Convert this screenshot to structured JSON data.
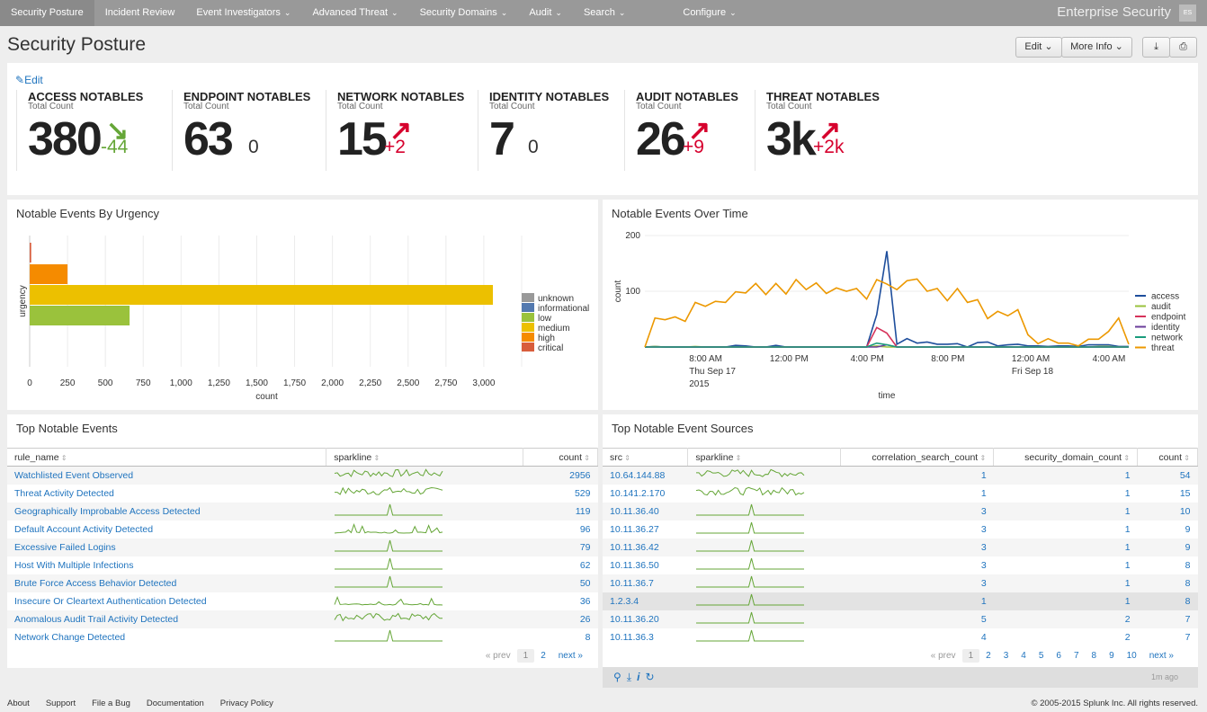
{
  "nav": {
    "tabs": [
      {
        "label": "Security Posture",
        "dropdown": false
      },
      {
        "label": "Incident Review",
        "dropdown": false
      },
      {
        "label": "Event Investigators",
        "dropdown": true
      },
      {
        "label": "Advanced Threat",
        "dropdown": true
      },
      {
        "label": "Security Domains",
        "dropdown": true
      },
      {
        "label": "Audit",
        "dropdown": true
      },
      {
        "label": "Search",
        "dropdown": true
      },
      {
        "label": "Configure",
        "dropdown": true
      }
    ],
    "brand": "Enterprise Security",
    "app_badge": "ES"
  },
  "page": {
    "title": "Security Posture",
    "edit_label": "Edit",
    "more_info_label": "More Info",
    "edit_link": "Edit"
  },
  "kpis": [
    {
      "title": "ACCESS NOTABLES",
      "subtitle": "Total Count",
      "value": "380",
      "delta": "-44",
      "trend": "down",
      "color": "#65a637"
    },
    {
      "title": "ENDPOINT NOTABLES",
      "subtitle": "Total Count",
      "value": "63",
      "delta": "0",
      "trend": "none",
      "color": "#333333"
    },
    {
      "title": "NETWORK NOTABLES",
      "subtitle": "Total Count",
      "value": "15",
      "delta": "+2",
      "trend": "up",
      "color": "#d6002d"
    },
    {
      "title": "IDENTITY NOTABLES",
      "subtitle": "Total Count",
      "value": "7",
      "delta": "0",
      "trend": "none",
      "color": "#333333"
    },
    {
      "title": "AUDIT NOTABLES",
      "subtitle": "Total Count",
      "value": "26",
      "delta": "+9",
      "trend": "up",
      "color": "#d6002d"
    },
    {
      "title": "THREAT NOTABLES",
      "subtitle": "Total Count",
      "value": "3k",
      "delta": "+2k",
      "trend": "up",
      "color": "#d6002d"
    }
  ],
  "chart_data": [
    {
      "type": "bar",
      "orientation": "horizontal",
      "title": "Notable Events By Urgency",
      "xlabel": "count",
      "ylabel": "urgency",
      "xlim": [
        0,
        3250
      ],
      "xticks": [
        0,
        250,
        500,
        750,
        1000,
        1250,
        1500,
        1750,
        2000,
        2250,
        2500,
        2750,
        3000
      ],
      "xtick_labels": [
        "0",
        "250",
        "500",
        "750",
        "1,000",
        "1,250",
        "1,500",
        "1,750",
        "2,000",
        "2,250",
        "2,500",
        "2,750",
        "3,000"
      ],
      "grid": true,
      "legend": "right",
      "series": [
        {
          "name": "unknown",
          "value": 0,
          "color": "#999999"
        },
        {
          "name": "informational",
          "value": 0,
          "color": "#5379af"
        },
        {
          "name": "low",
          "value": 660,
          "color": "#9ac23c"
        },
        {
          "name": "medium",
          "value": 3060,
          "color": "#ecc000"
        },
        {
          "name": "high",
          "value": 250,
          "color": "#f58b00"
        },
        {
          "name": "critical",
          "value": 10,
          "color": "#d85d3c"
        }
      ]
    },
    {
      "type": "line",
      "title": "Notable Events Over Time",
      "xlabel": "time",
      "ylabel": "count",
      "ylim": [
        0,
        200
      ],
      "yticks": [
        100,
        200
      ],
      "x_start": "2015-09-17 05:00",
      "x_step_minutes": 30,
      "xtick_labels": [
        {
          "at_index": 6,
          "lines": [
            "8:00 AM",
            "Thu Sep 17",
            "2015"
          ]
        },
        {
          "at_index": 14,
          "lines": [
            "12:00 PM"
          ]
        },
        {
          "at_index": 22,
          "lines": [
            "4:00 PM"
          ]
        },
        {
          "at_index": 30,
          "lines": [
            "8:00 PM"
          ]
        },
        {
          "at_index": 38,
          "lines": [
            "12:00 AM",
            "Fri Sep 18"
          ]
        },
        {
          "at_index": 46,
          "lines": [
            "4:00 AM"
          ]
        }
      ],
      "legend": "right",
      "grid": true,
      "series": [
        {
          "name": "access",
          "color": "#1e4e9c",
          "values": [
            0,
            1,
            0,
            0,
            0,
            0,
            0,
            0,
            0,
            3,
            2,
            0,
            0,
            3,
            0,
            0,
            0,
            0,
            0,
            0,
            0,
            0,
            0,
            58,
            172,
            5,
            15,
            7,
            9,
            5,
            5,
            6,
            0,
            8,
            9,
            2,
            4,
            5,
            2,
            2,
            1,
            2,
            2,
            1,
            4,
            4,
            4,
            1,
            1
          ]
        },
        {
          "name": "audit",
          "color": "#9ac23c",
          "values": [
            0,
            1,
            0,
            0,
            0,
            1,
            0,
            0,
            0,
            0,
            0,
            0,
            0,
            0,
            0,
            0,
            0,
            0,
            0,
            0,
            0,
            0,
            0,
            2,
            0,
            0,
            0,
            0,
            0,
            0,
            0,
            0,
            0,
            0,
            0,
            0,
            0,
            0,
            0,
            0,
            0,
            0,
            0,
            0,
            0,
            1,
            1,
            0,
            0
          ]
        },
        {
          "name": "endpoint",
          "color": "#d6335a",
          "values": [
            0,
            0,
            0,
            0,
            0,
            0,
            0,
            0,
            0,
            0,
            0,
            0,
            0,
            0,
            0,
            0,
            0,
            0,
            0,
            0,
            0,
            0,
            0,
            35,
            25,
            0,
            0,
            0,
            0,
            0,
            0,
            0,
            0,
            0,
            0,
            0,
            0,
            0,
            0,
            0,
            0,
            0,
            0,
            0,
            0,
            0,
            0,
            0,
            0
          ]
        },
        {
          "name": "identity",
          "color": "#6a3d9a",
          "values": [
            0,
            0,
            0,
            0,
            0,
            0,
            0,
            0,
            0,
            0,
            0,
            0,
            0,
            0,
            0,
            0,
            0,
            0,
            0,
            0,
            0,
            0,
            0,
            0,
            4,
            0,
            0,
            0,
            0,
            0,
            0,
            0,
            0,
            0,
            0,
            0,
            0,
            0,
            0,
            0,
            0,
            0,
            0,
            0,
            0,
            0,
            0,
            0,
            0
          ]
        },
        {
          "name": "network",
          "color": "#1a9c7c",
          "values": [
            0,
            0,
            0,
            0,
            0,
            0,
            0,
            0,
            0,
            0,
            0,
            0,
            0,
            0,
            0,
            0,
            0,
            0,
            0,
            0,
            0,
            0,
            0,
            7,
            4,
            0,
            0,
            0,
            0,
            0,
            0,
            0,
            0,
            0,
            0,
            0,
            0,
            0,
            0,
            0,
            0,
            0,
            0,
            0,
            0,
            0,
            0,
            0,
            0
          ]
        },
        {
          "name": "threat",
          "color": "#ec9800",
          "values": [
            0,
            52,
            49,
            54,
            46,
            80,
            73,
            82,
            80,
            99,
            97,
            114,
            94,
            114,
            95,
            121,
            103,
            115,
            96,
            106,
            100,
            105,
            86,
            121,
            113,
            103,
            119,
            122,
            100,
            105,
            83,
            105,
            80,
            85,
            51,
            64,
            56,
            67,
            22,
            6,
            15,
            7,
            7,
            2,
            14,
            14,
            28,
            52,
            5
          ]
        }
      ]
    }
  ],
  "top_events": {
    "title": "Top Notable Events",
    "columns": [
      "rule_name",
      "sparkline",
      "count"
    ],
    "rows": [
      [
        "Watchlisted Event Observed",
        "dense",
        "2956"
      ],
      [
        "Threat Activity Detected",
        "dense",
        "529"
      ],
      [
        "Geographically Improbable Access Detected",
        "spike",
        "119"
      ],
      [
        "Default Account Activity Detected",
        "sparse",
        "96"
      ],
      [
        "Excessive Failed Logins",
        "spike",
        "79"
      ],
      [
        "Host With Multiple Infections",
        "spike",
        "62"
      ],
      [
        "Brute Force Access Behavior Detected",
        "spike",
        "50"
      ],
      [
        "Insecure Or Cleartext Authentication Detected",
        "sparse",
        "36"
      ],
      [
        "Anomalous Audit Trail Activity Detected",
        "dense",
        "26"
      ],
      [
        "Network Change Detected",
        "spike",
        "8"
      ]
    ],
    "pager": {
      "prev": "« prev",
      "pages": [
        "1",
        "2"
      ],
      "current": "1",
      "next": "next »"
    }
  },
  "top_sources": {
    "title": "Top Notable Event Sources",
    "columns": [
      "src",
      "sparkline",
      "correlation_search_count",
      "security_domain_count",
      "count"
    ],
    "rows": [
      [
        "10.64.144.88",
        "dense",
        "1",
        "1",
        "54"
      ],
      [
        "10.141.2.170",
        "dense",
        "1",
        "1",
        "15"
      ],
      [
        "10.11.36.40",
        "spike",
        "3",
        "1",
        "10"
      ],
      [
        "10.11.36.27",
        "spike",
        "3",
        "1",
        "9"
      ],
      [
        "10.11.36.42",
        "spike",
        "3",
        "1",
        "9"
      ],
      [
        "10.11.36.50",
        "spike",
        "3",
        "1",
        "8"
      ],
      [
        "10.11.36.7",
        "spike",
        "3",
        "1",
        "8"
      ],
      [
        "1.2.3.4",
        "spike",
        "1",
        "1",
        "8"
      ],
      [
        "10.11.36.20",
        "spike",
        "5",
        "2",
        "7"
      ],
      [
        "10.11.36.3",
        "spike",
        "4",
        "2",
        "7"
      ]
    ],
    "pager": {
      "prev": "« prev",
      "pages": [
        "1",
        "2",
        "3",
        "4",
        "5",
        "6",
        "7",
        "8",
        "9",
        "10"
      ],
      "current": "1",
      "next": "next »"
    },
    "updated": "1m ago"
  },
  "footer": {
    "links": [
      "About",
      "Support",
      "File a Bug",
      "Documentation",
      "Privacy Policy"
    ],
    "copyright": "© 2005-2015 Splunk Inc. All rights reserved."
  }
}
